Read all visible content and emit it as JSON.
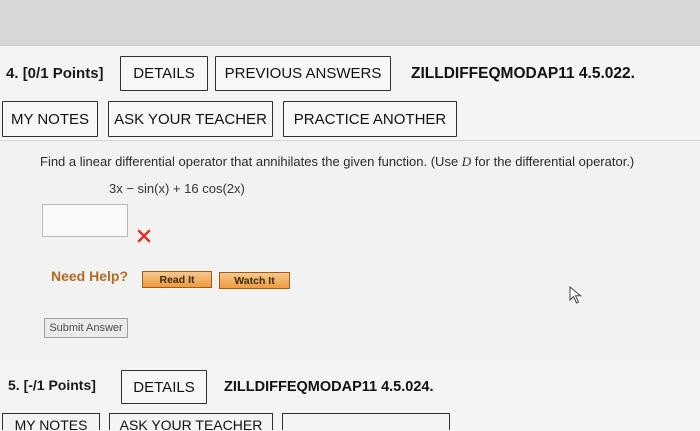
{
  "question4": {
    "number": "4.",
    "points": "[0/1 Points]",
    "details_label": "DETAILS",
    "previous_answers_label": "PREVIOUS ANSWERS",
    "code": "ZILLDIFFEQMODAP11 4.5.022.",
    "my_notes_label": "MY NOTES",
    "ask_teacher_label": "ASK YOUR TEACHER",
    "practice_another_label": "PRACTICE ANOTHER",
    "prompt_prefix": "Find a linear differential operator that annihilates the given function. (Use ",
    "prompt_var": "D",
    "prompt_suffix": " for the differential operator.)",
    "expression": "3x − sin(x) + 16 cos(2x)",
    "answer_value": "",
    "status_icon": "red-x-icon",
    "need_help_label": "Need Help?",
    "read_it_label": "Read It",
    "watch_it_label": "Watch It",
    "submit_label": "Submit Answer"
  },
  "question5": {
    "number": "5.",
    "points": "[-/1 Points]",
    "details_label": "DETAILS",
    "code": "ZILLDIFFEQMODAP11 4.5.024.",
    "my_notes_label": "MY NOTES",
    "ask_teacher_label": "ASK YOUR TEACHER"
  },
  "colors": {
    "error_red": "#e0332b",
    "need_help_orange": "#b36a1f",
    "help_button": "#ef9a3f"
  }
}
